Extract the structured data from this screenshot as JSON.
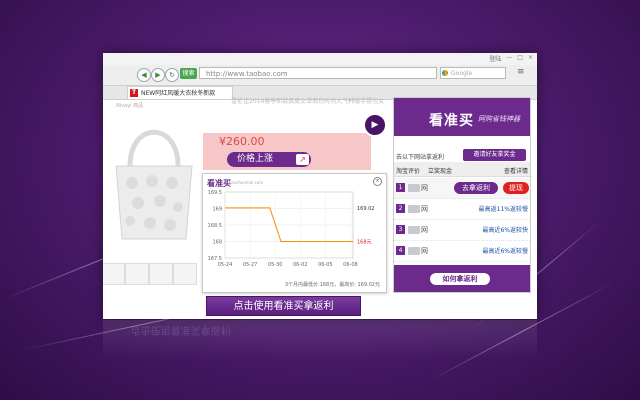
{
  "browser": {
    "window_buttons": [
      "登陆",
      "—",
      "□",
      "×"
    ],
    "search_mode_label": "搜索",
    "url": "http://www.taobao.com",
    "search_placeholder": "Google",
    "tab_favicon": "T",
    "tab_title": "NEW阿红风暖大衣秋冬新款"
  },
  "product": {
    "breadcrumb": "Nivayi 商品",
    "title": "雪伦佳2014春季新款真皮女单肩包时尚大气韩版手提包女",
    "price": "¥260.00",
    "price_trend_label": "价格上涨",
    "price_trend_icon": "arrow-up-icon"
  },
  "popup": {
    "logo": "看准买",
    "site": "kanzhunmai.com",
    "close_label": "×",
    "footer": "3个月内最低价:168元，最高价: 169.02元"
  },
  "chart_data": {
    "type": "line",
    "x_ticks": [
      "05-24",
      "05-27",
      "05-30",
      "06-02",
      "06-05",
      "06-08"
    ],
    "y_ticks": [
      "167.5",
      "168",
      "168.5",
      "169",
      "169.5"
    ],
    "ylim": [
      167.5,
      169.5
    ],
    "series": [
      {
        "points": [
          [
            0,
            169.02
          ],
          [
            2.8,
            169.02
          ],
          [
            3.5,
            168.0
          ],
          [
            8.0,
            168.0
          ]
        ]
      }
    ],
    "annotations": [
      {
        "text": "169.02",
        "y": 169.02,
        "color": "#333333"
      },
      {
        "text": "168元",
        "y": 168.0,
        "color": "#e02020"
      }
    ],
    "line_color": "#ff8a00",
    "grid": true
  },
  "cta": {
    "label": "点击使用看准买拿返利"
  },
  "panel": {
    "brand": "看准买",
    "slogan": "网购省钱神器",
    "invite_hint": "去以下网站拿返利",
    "invite_button": "邀请好友拿奖金",
    "columns": [
      "淘宝评价",
      "立奖现金",
      "查看详情"
    ],
    "rows": [
      {
        "rank": "1",
        "store": "网",
        "primary_button": "去拿返利",
        "secondary_button": "提现"
      },
      {
        "rank": "2",
        "store": "网",
        "rate": "最高返11%返较慢"
      },
      {
        "rank": "3",
        "store": "网",
        "rate": "最高近6%返较快"
      },
      {
        "rank": "4",
        "store": "网",
        "rate": "最高近6%返较慢"
      }
    ],
    "footer_button": "如何拿返利"
  },
  "colors": {
    "accent": "#6b2a8c",
    "price_bg": "#f7c6c6",
    "line": "#ff8a00",
    "warn": "#e02020"
  }
}
